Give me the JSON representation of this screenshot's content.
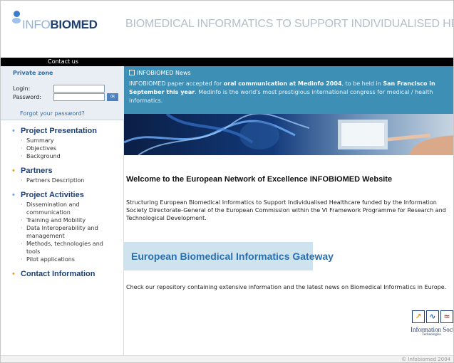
{
  "header": {
    "logo_light": "INFO",
    "logo_bold": "BIOMED",
    "tagline": "BIOMEDICAL INFORMATICS TO SUPPORT INDIVIDUALISED HEALTHCARE",
    "contact_label": "Contact us"
  },
  "private_zone": {
    "title": "Private zone",
    "login_label": "Login:",
    "password_label": "Password:",
    "ok_label": "ok",
    "forgot_label": "Forgot your password?"
  },
  "nav": {
    "project_presentation": {
      "title": "Project Presentation",
      "items": [
        "Summary",
        "Objectives",
        "Background"
      ]
    },
    "partners": {
      "title": "Partners",
      "items": [
        "Partners Description"
      ]
    },
    "project_activities": {
      "title": "Project Activities",
      "items": [
        "Dissemination and communication",
        "Training and Mobility",
        "Data Interoperability and management",
        "Methods, technologies and tools",
        "Pilot applications"
      ]
    },
    "contact_information": {
      "title": "Contact Information"
    }
  },
  "news": {
    "title": "INFOBIOMED News",
    "text_1": "INFOBIOMED paper accepted for ",
    "text_bold_1": "oral communication at Medinfo 2004",
    "text_2": ", to be held in ",
    "text_bold_2": "San Francisco in September this year",
    "text_3": ". Medinfo is the world's most prestigious international congress for medical / health informatics."
  },
  "main": {
    "welcome_title": "Welcome to the European Network of Excellence INFOBIOMED Website",
    "intro_text": "Structuring European Biomedical Informatics to Support Individualised Healthcare funded by the Information Society Directorate-General of the European Commission within the VI Framework Programme for Research and Technological Development.",
    "gateway_label": "European Biomedical Informatics Gateway",
    "repository_text": "Check our repository containing extensive information and the latest news on Biomedical Informatics in Europe.",
    "ist_label": "Information Society",
    "ist_sublabel": "Technologies"
  },
  "footer": {
    "copyright": "© Infobiomed 2004"
  },
  "colors": {
    "news_bg": "#3d8fb5",
    "nav_title": "#1d3f73",
    "bullet_orange": "#e7a22b",
    "link_blue": "#2f67a5",
    "gateway_bg": "#cfe3ef"
  }
}
